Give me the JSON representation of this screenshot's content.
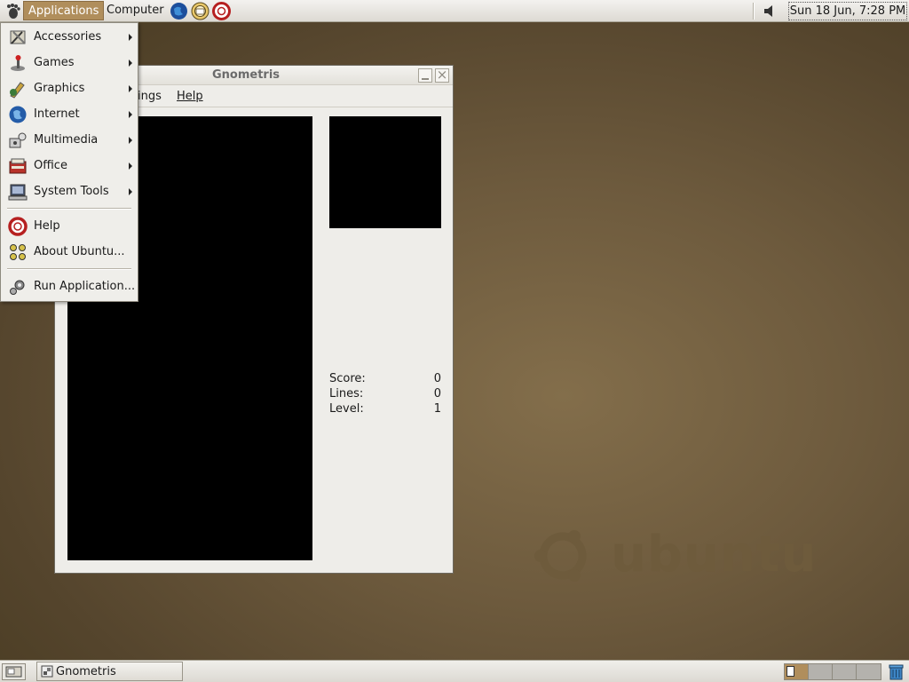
{
  "top_panel": {
    "applications_label": "Applications",
    "computer_label": "Computer",
    "launchers": [
      "web-browser-icon",
      "email-icon",
      "help-icon"
    ],
    "clock": "Sun 18 Jun,  7:28 PM"
  },
  "app_menu": {
    "items": [
      {
        "label": "Accessories",
        "icon": "accessories-icon",
        "submenu": true
      },
      {
        "label": "Games",
        "icon": "games-icon",
        "submenu": true
      },
      {
        "label": "Graphics",
        "icon": "graphics-icon",
        "submenu": true
      },
      {
        "label": "Internet",
        "icon": "internet-icon",
        "submenu": true
      },
      {
        "label": "Multimedia",
        "icon": "multimedia-icon",
        "submenu": true
      },
      {
        "label": "Office",
        "icon": "office-icon",
        "submenu": true
      },
      {
        "label": "System Tools",
        "icon": "system-tools-icon",
        "submenu": true
      },
      {
        "label": "Help",
        "icon": "help-icon",
        "submenu": false
      },
      {
        "label": "About Ubuntu...",
        "icon": "about-ubuntu-icon",
        "submenu": false
      },
      {
        "label": "Run Application...",
        "icon": "run-application-icon",
        "submenu": false
      }
    ]
  },
  "window": {
    "title": "Gnometris",
    "menubar": {
      "settings_partial": "ings",
      "help": "Help"
    },
    "stats": {
      "score_label": "Score:",
      "score": "0",
      "lines_label": "Lines:",
      "lines": "0",
      "level_label": "Level:",
      "level": "1"
    }
  },
  "desktop": {
    "logo_text": "ubuntu"
  },
  "bottom_panel": {
    "task_label": "Gnometris",
    "workspace_count": 4,
    "active_workspace": 1
  },
  "colors": {
    "accent": "#b08e5c",
    "desktop": "#6d5a3d",
    "panel": "#e9e7e1"
  }
}
